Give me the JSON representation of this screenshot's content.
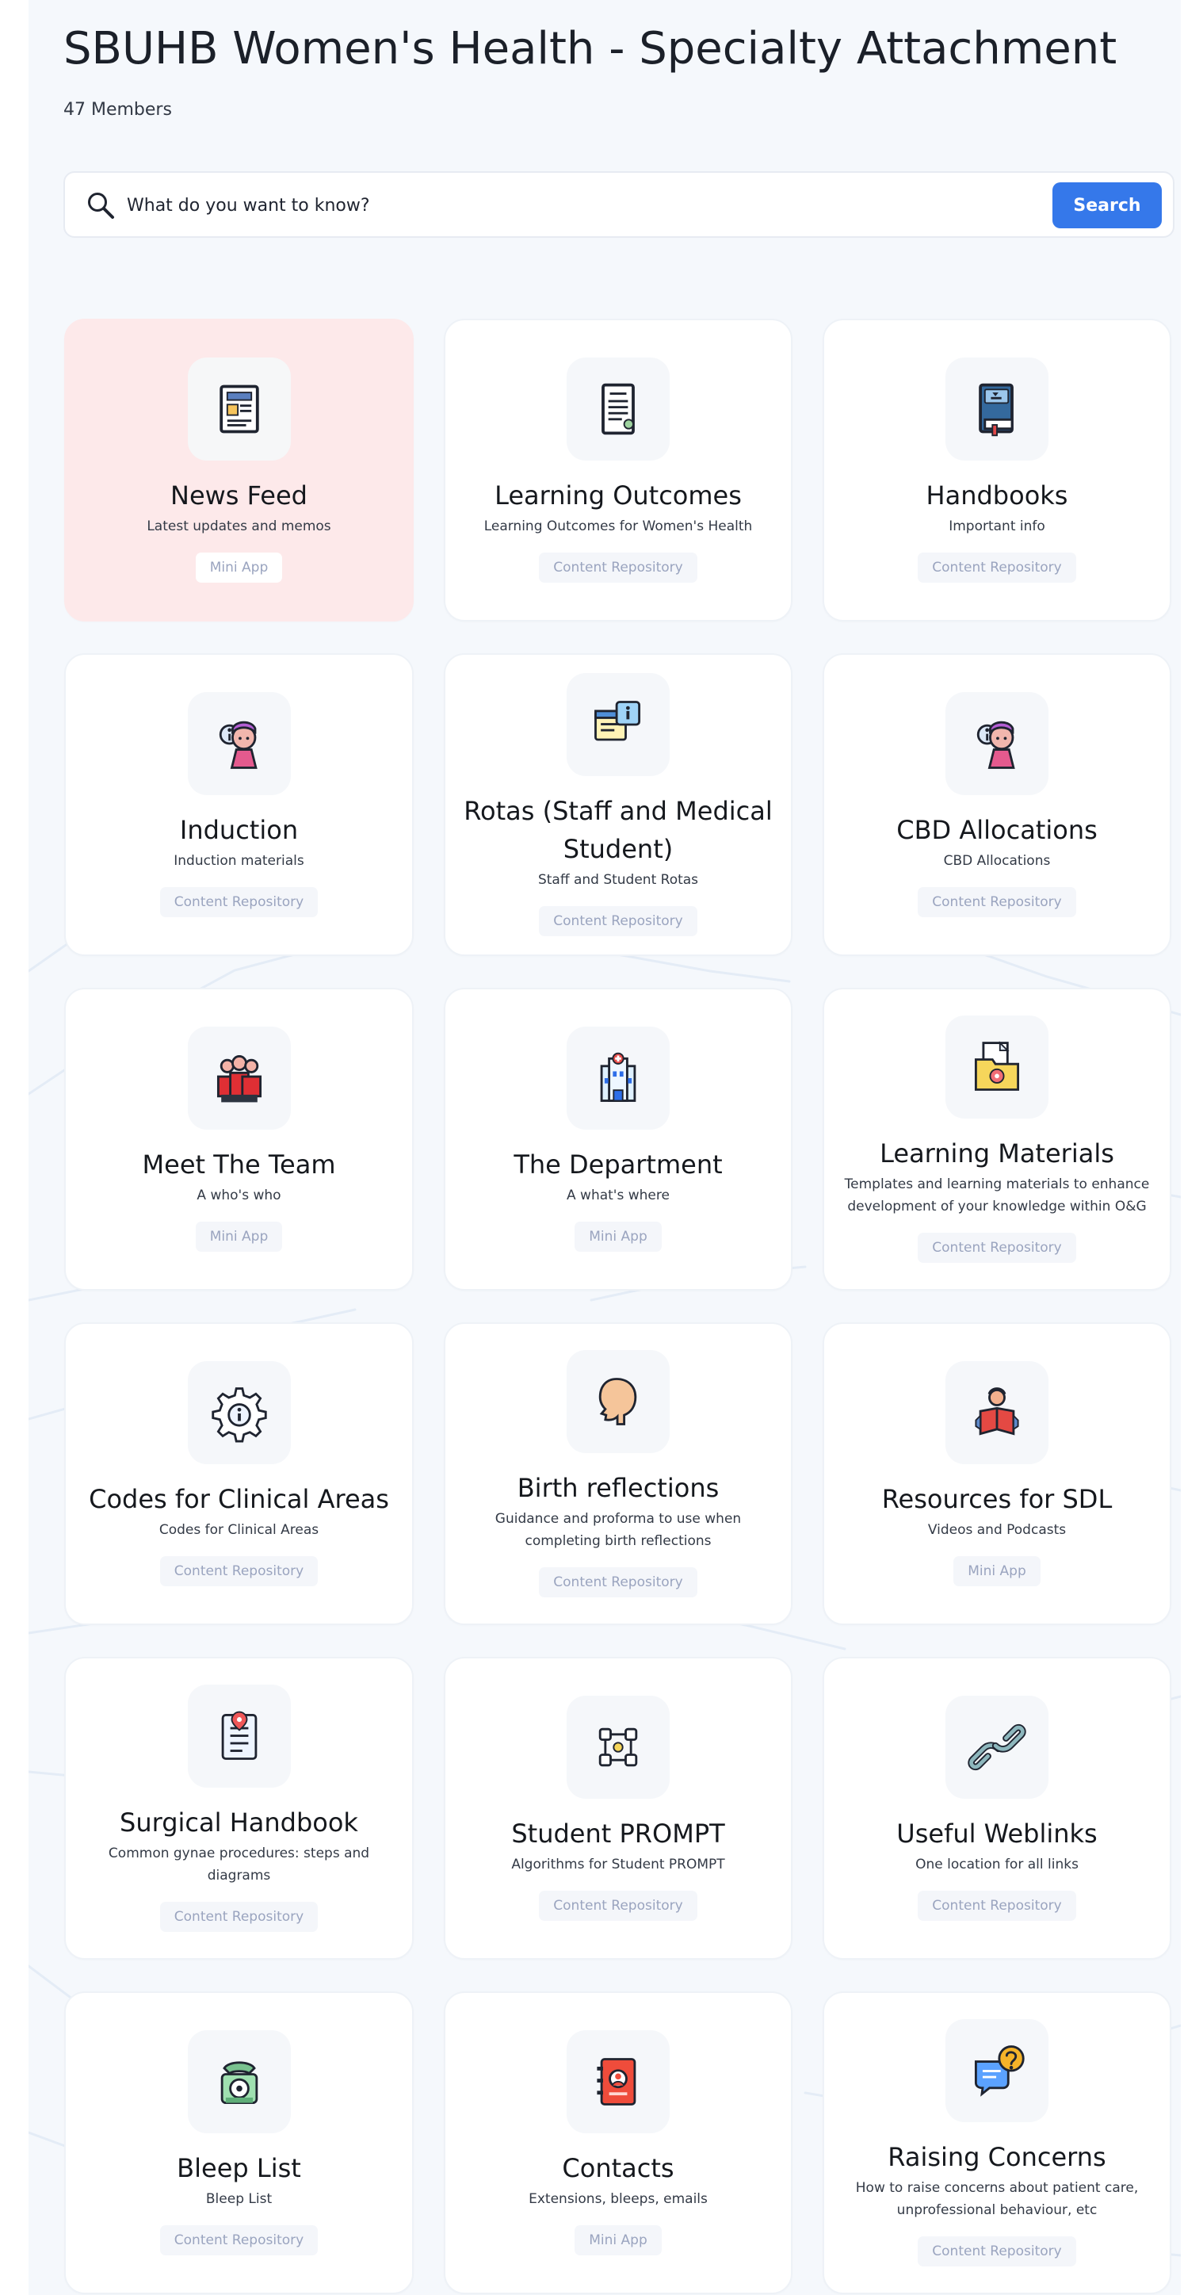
{
  "header": {
    "title": "SBUHB Women's Health - Specialty Attachment",
    "members": "47 Members"
  },
  "search": {
    "placeholder": "What do you want to know?",
    "button": "Search"
  },
  "colors": {
    "accent": "#3578ea",
    "highlight_card": "#fde9ea",
    "badge_text": "#9aa4bf"
  },
  "cards": [
    {
      "title": "News Feed",
      "subtitle": "Latest updates and memos",
      "badge": "Mini App",
      "icon": "newspaper-icon",
      "highlight": true
    },
    {
      "title": "Learning Outcomes",
      "subtitle": "Learning Outcomes for Women's Health",
      "badge": "Content Repository",
      "icon": "document-icon"
    },
    {
      "title": "Handbooks",
      "subtitle": "Important info",
      "badge": "Content Repository",
      "icon": "book-icon"
    },
    {
      "title": "Induction",
      "subtitle": "Induction materials",
      "badge": "Content Repository",
      "icon": "user-info-icon"
    },
    {
      "title": "Rotas (Staff and Medical\nStudent)",
      "subtitle": "Staff and Student Rotas",
      "badge": "Content Repository",
      "icon": "calendar-info-icon"
    },
    {
      "title": "CBD Allocations",
      "subtitle": "CBD Allocations",
      "badge": "Content Repository",
      "icon": "user-info-icon"
    },
    {
      "title": "Meet The Team",
      "subtitle": "A who's who",
      "badge": "Mini App",
      "icon": "team-icon"
    },
    {
      "title": "The Department",
      "subtitle": "A what's where",
      "badge": "Mini App",
      "icon": "hospital-icon"
    },
    {
      "title": "Learning Materials",
      "subtitle": "Templates and learning materials to enhance\ndevelopment of your knowledge within O&G",
      "badge": "Content Repository",
      "icon": "folder-icon"
    },
    {
      "title": "Codes for Clinical Areas",
      "subtitle": "Codes for Clinical Areas",
      "badge": "Content Repository",
      "icon": "gear-info-icon"
    },
    {
      "title": "Birth reflections",
      "subtitle": "Guidance and proforma to use when\ncompleting birth reflections",
      "badge": "Content Repository",
      "icon": "head-icon"
    },
    {
      "title": "Resources for SDL",
      "subtitle": "Videos and Podcasts",
      "badge": "Mini App",
      "icon": "reader-icon"
    },
    {
      "title": "Surgical Handbook",
      "subtitle": "Common gynae procedures: steps and\ndiagrams",
      "badge": "Content Repository",
      "icon": "clipboard-pin-icon"
    },
    {
      "title": "Student PROMPT",
      "subtitle": "Algorithms for Student PROMPT",
      "badge": "Content Repository",
      "icon": "workflow-icon"
    },
    {
      "title": "Useful Weblinks",
      "subtitle": "One location for all links",
      "badge": "Content Repository",
      "icon": "link-icon"
    },
    {
      "title": "Bleep List",
      "subtitle": "Bleep List",
      "badge": "Content Repository",
      "icon": "phone-icon"
    },
    {
      "title": "Contacts",
      "subtitle": "Extensions, bleeps, emails",
      "badge": "Mini App",
      "icon": "address-book-icon"
    },
    {
      "title": "Raising Concerns",
      "subtitle": "How to raise concerns about patient care,\nunprofessional behaviour, etc",
      "badge": "Content Repository",
      "icon": "question-chat-icon"
    }
  ]
}
